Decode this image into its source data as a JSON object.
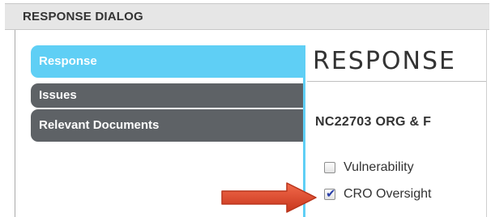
{
  "dialog": {
    "title": "RESPONSE DIALOG"
  },
  "nav": {
    "items": [
      {
        "label": "Response",
        "active": true
      },
      {
        "label": "Issues",
        "active": false
      },
      {
        "label": "Relevant Documents",
        "active": false
      }
    ]
  },
  "content": {
    "heading": "RESPONSE",
    "record": "NC22703   ORG & F",
    "checkboxes": [
      {
        "label": "Vulnerability",
        "checked": false
      },
      {
        "label": "CRO Oversight",
        "checked": true
      }
    ]
  },
  "annotation": {
    "icon": "red-arrow-icon",
    "color": "#e8482b",
    "points_to": "CRO Oversight"
  },
  "colors": {
    "accent": "#5fcff5",
    "nav_dark": "#5e6266",
    "title_bar": "#e6e6e6",
    "text": "#333333"
  }
}
